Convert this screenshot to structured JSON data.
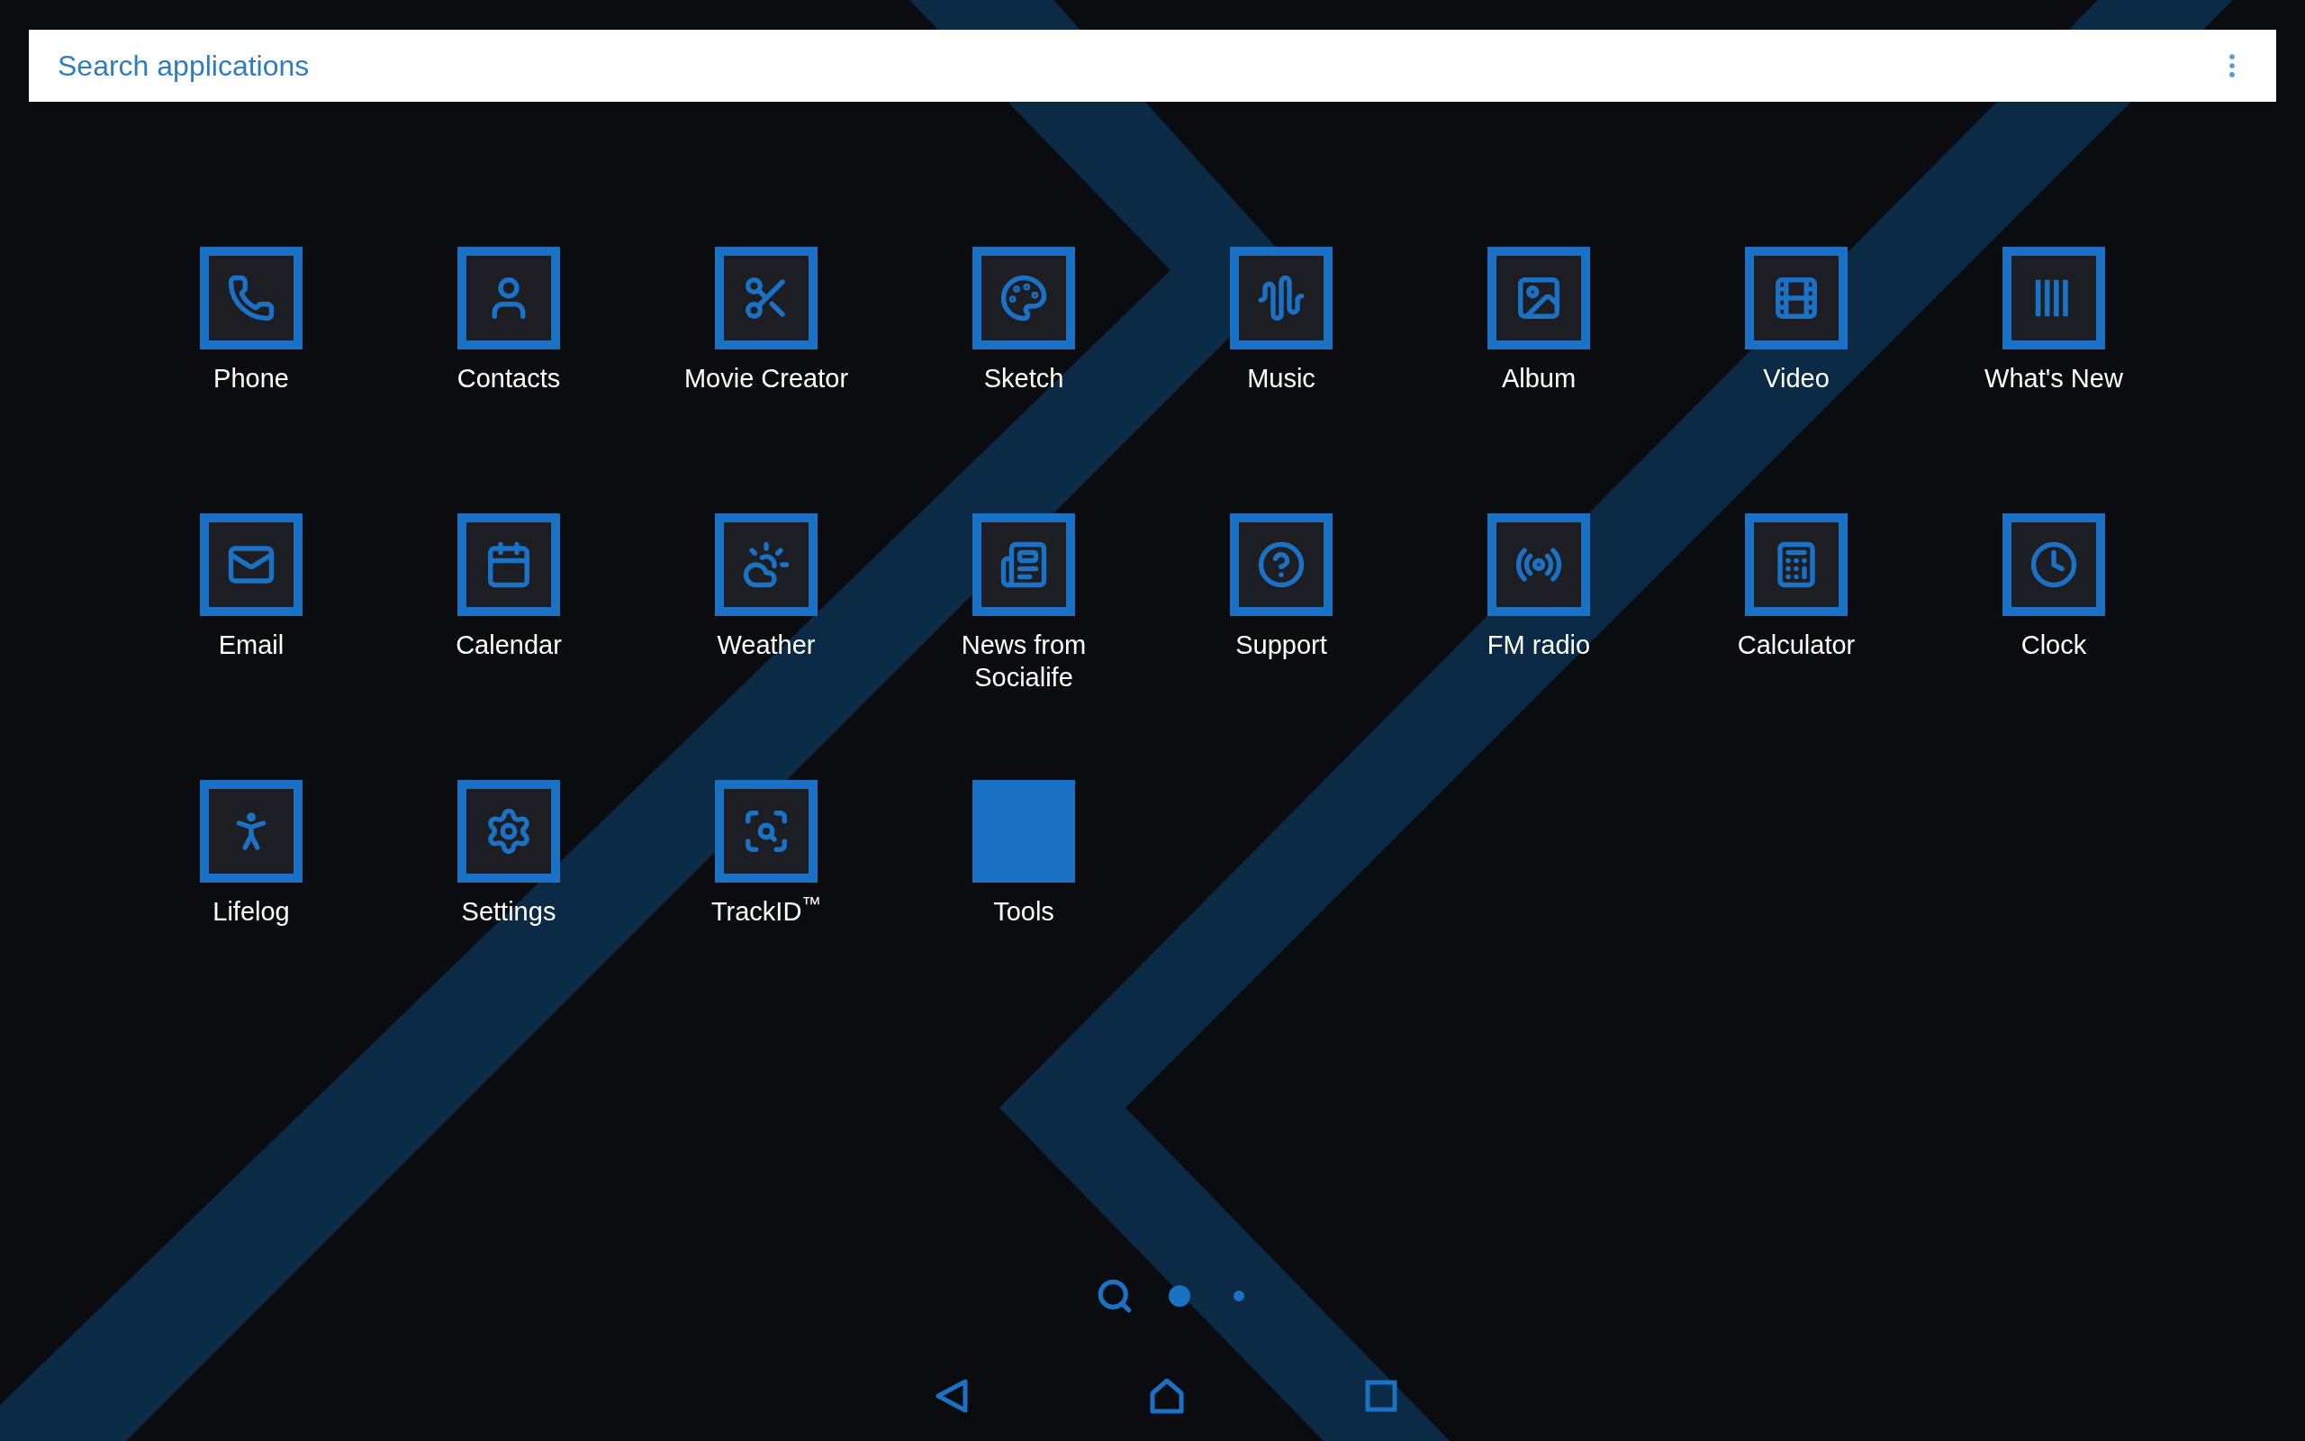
{
  "search": {
    "placeholder": "Search applications"
  },
  "apps": [
    {
      "label": "Phone",
      "kind": "app"
    },
    {
      "label": "Contacts",
      "kind": "app"
    },
    {
      "label": "Movie Creator",
      "kind": "app"
    },
    {
      "label": "Sketch",
      "kind": "app"
    },
    {
      "label": "Music",
      "kind": "app"
    },
    {
      "label": "Album",
      "kind": "app"
    },
    {
      "label": "Video",
      "kind": "app"
    },
    {
      "label": "What's New",
      "kind": "app"
    },
    {
      "label": "Email",
      "kind": "app"
    },
    {
      "label": "Calendar",
      "kind": "app"
    },
    {
      "label": "Weather",
      "kind": "app"
    },
    {
      "label": "News from Socialife",
      "kind": "app"
    },
    {
      "label": "Support",
      "kind": "app"
    },
    {
      "label": "FM radio",
      "kind": "app"
    },
    {
      "label": "Calculator",
      "kind": "app"
    },
    {
      "label": "Clock",
      "kind": "app"
    },
    {
      "label": "Lifelog",
      "kind": "app"
    },
    {
      "label": "Settings",
      "kind": "app"
    },
    {
      "label": "TrackID$^{™}$",
      "kind": "app"
    },
    {
      "label": "Tools",
      "kind": "folder"
    }
  ],
  "pages": [
    {
      "selected": true
    },
    {
      "selected": false
    }
  ]
}
